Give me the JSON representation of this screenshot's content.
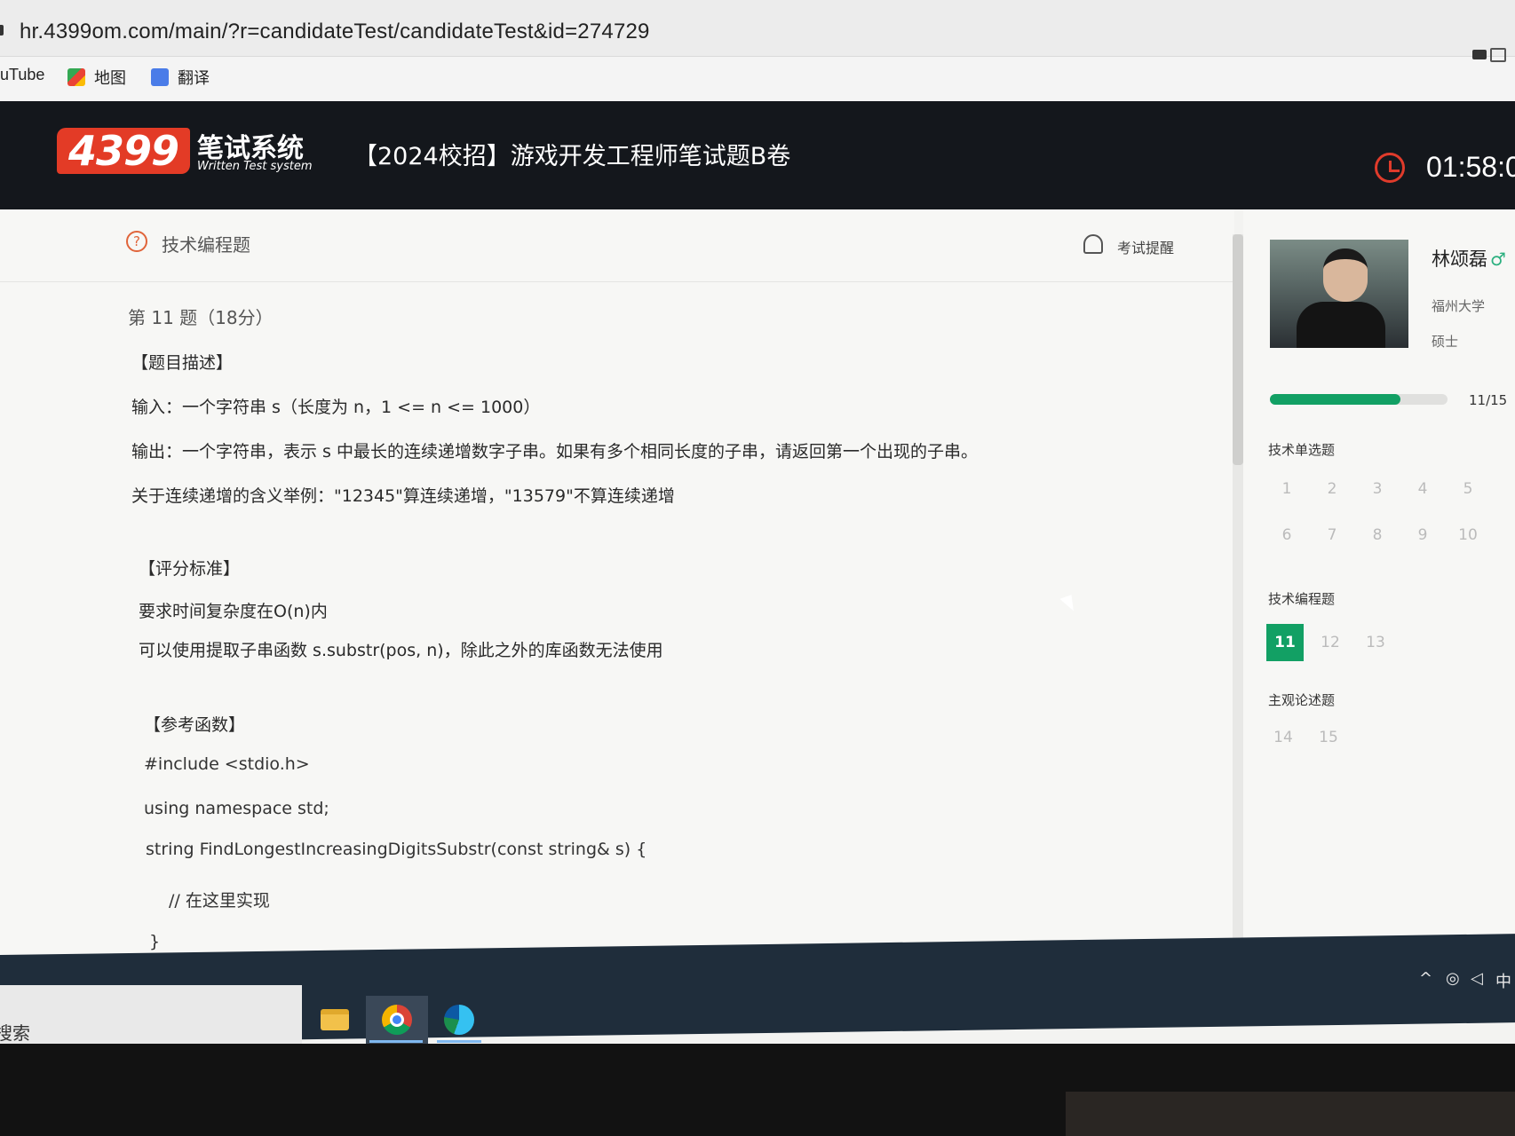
{
  "browser": {
    "url": "hr.4399om.com/main/?r=candidateTest/candidateTest&id=274729",
    "bookmarks": [
      {
        "label": "uTube",
        "icon": "youtube-icon"
      },
      {
        "label": "地图",
        "icon": "maps-icon"
      },
      {
        "label": "翻译",
        "icon": "translate-icon"
      }
    ]
  },
  "header": {
    "logo_number": "4399",
    "logo_cn": "笔试系统",
    "logo_en": "Written Test system",
    "exam_title": "【2024校招】游戏开发工程师笔试题B卷",
    "timer": "01:58:0"
  },
  "main": {
    "section_title": "技术编程题",
    "remind_label": "考试提醒",
    "question_header": "第 11 题（18分）",
    "lines": [
      "【题目描述】",
      "输入：一个字符串 s（长度为 n，1 <= n <= 1000）",
      "输出：一个字符串，表示 s 中最长的连续递增数字子串。如果有多个相同长度的子串，请返回第一个出现的子串。",
      "关于连续递增的含义举例：\"12345\"算连续递增，\"13579\"不算连续递增",
      "【评分标准】",
      "要求时间复杂度在O(n)内",
      "可以使用提取子串函数 s.substr(pos, n)，除此之外的库函数无法使用",
      "【参考函数】",
      "#include <stdio.h>",
      "using namespace std;",
      "string FindLongestIncreasingDigitsSubstr(const string& s) {",
      "// 在这里实现",
      "}"
    ]
  },
  "sidebar": {
    "candidate_name": "林颂磊",
    "gender_symbol": "♂",
    "school": "福州大学",
    "degree": "硕士",
    "progress_text": "11/15",
    "progress_fraction": 0.7333,
    "accent_color": "#12a064",
    "groups": [
      {
        "title": "技术单选题",
        "numbers": [
          "1",
          "2",
          "3",
          "4",
          "5",
          "6",
          "7",
          "8",
          "9",
          "10"
        ]
      },
      {
        "title": "技术编程题",
        "numbers": [
          "11",
          "12",
          "13"
        ]
      },
      {
        "title": "主观论述题",
        "numbers": [
          "14",
          "15"
        ]
      }
    ],
    "current_question": "11"
  },
  "taskbar": {
    "search_text": "搜索",
    "apps": [
      "file-explorer-icon",
      "chrome-icon",
      "edge-icon"
    ],
    "tray": {
      "ime": "中"
    }
  }
}
